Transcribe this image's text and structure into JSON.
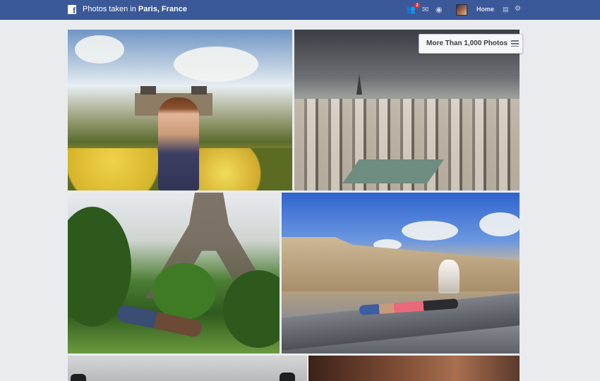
{
  "app": "Facebook",
  "topbar": {
    "crumb_prefix": "Photos taken in",
    "crumb_place": "Paris, France",
    "notification_badge": "2",
    "home_label": "Home"
  },
  "photos_button": {
    "label": "More Than 1,000 Photos"
  },
  "photos": [
    {
      "name": "woman-in-garden"
    },
    {
      "name": "paris-skyline"
    },
    {
      "name": "eiffel-tower-lawn"
    },
    {
      "name": "louvre-fountain"
    },
    {
      "name": "gate-silhouette"
    },
    {
      "name": "close-up-hand"
    }
  ],
  "colors": {
    "brand": "#3b5998",
    "background": "#e9ebee",
    "badge": "#e02c2c"
  }
}
